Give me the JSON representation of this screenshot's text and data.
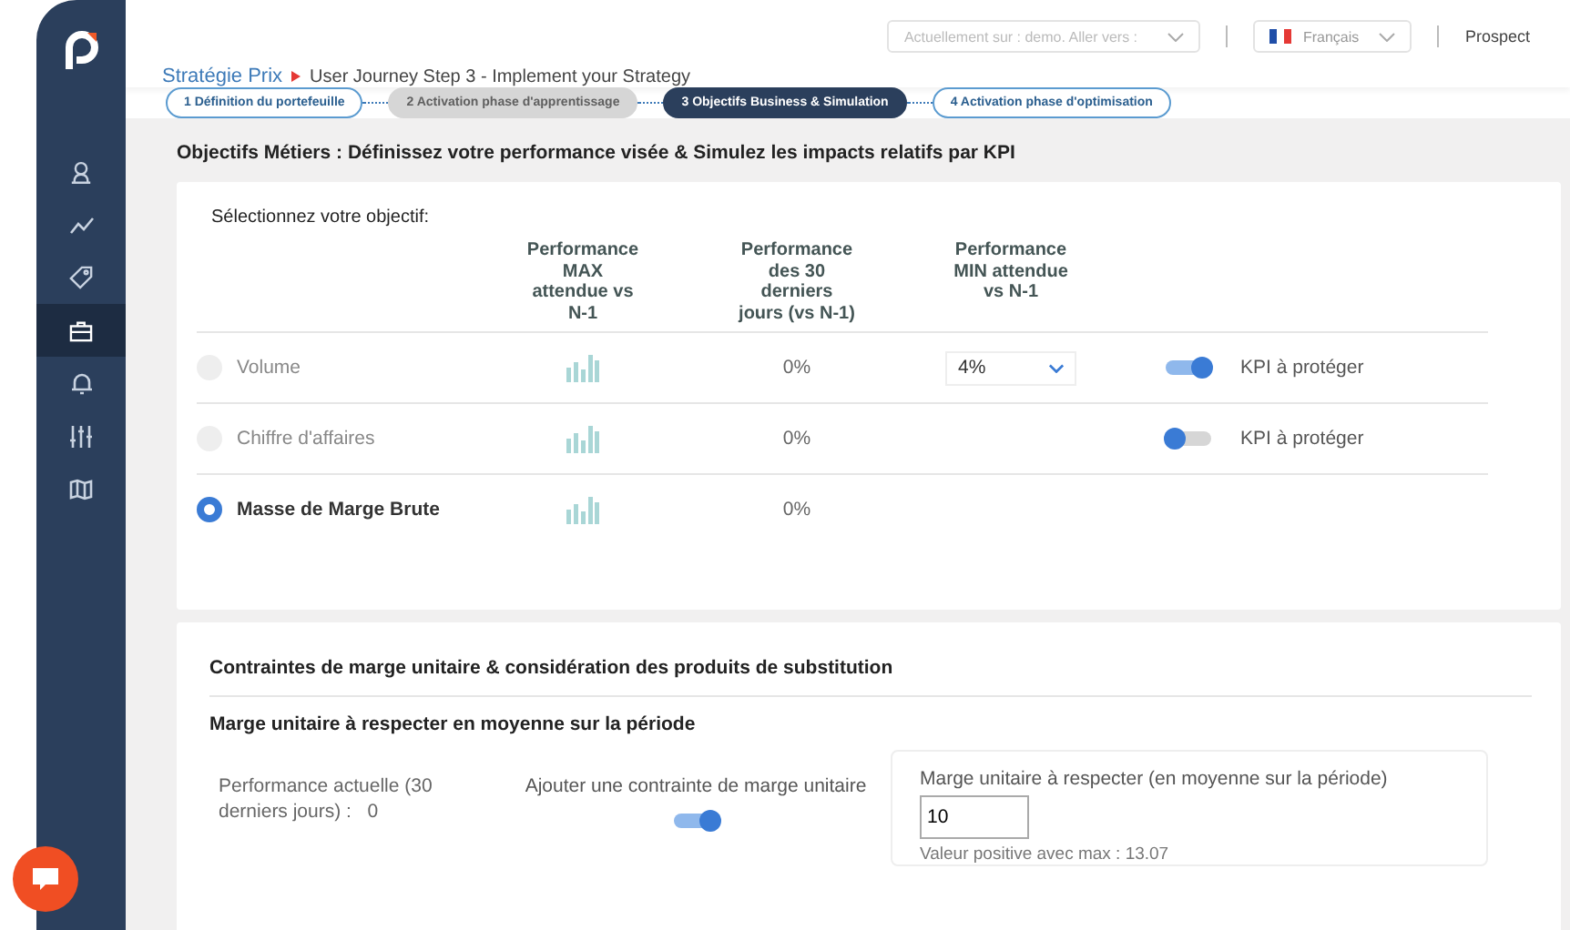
{
  "header": {
    "site_select": {
      "placeholder": "Actuellement sur : demo. Aller vers :"
    },
    "language_select": {
      "value": "Français"
    },
    "user": "Prospect"
  },
  "sidebar": {
    "items": [
      {
        "kind": "user",
        "selected": false
      },
      {
        "kind": "trend",
        "selected": false
      },
      {
        "kind": "tag",
        "selected": false
      },
      {
        "kind": "briefcase",
        "selected": true
      },
      {
        "kind": "bell",
        "selected": false
      },
      {
        "kind": "sliders",
        "selected": false
      },
      {
        "kind": "map",
        "selected": false
      }
    ]
  },
  "breadcrumb": {
    "parent": "Stratégie Prix",
    "current": "User Journey Step 3 - Implement your Strategy"
  },
  "steps": [
    {
      "label": "1 Définition du portefeuille",
      "selected": false,
      "disabled": false
    },
    {
      "label": "2 Activation phase d'apprentissage",
      "selected": false,
      "disabled": true
    },
    {
      "label": "3 Objectifs Business & Simulation",
      "selected": true,
      "disabled": false
    },
    {
      "label": "4 Activation phase d'optimisation",
      "selected": false,
      "disabled": false
    }
  ],
  "objectives": {
    "title": "Objectifs Métiers : Définissez votre performance visée & Simulez les impacts relatifs par KPI",
    "prompt": "Sélectionnez votre objectif:",
    "columns": [
      "Performance MAX attendue vs N-1",
      "Performance des 30 derniers jours (vs N-1)",
      "Performance MIN attendue vs N-1"
    ],
    "rows": [
      {
        "name": "Volume",
        "selected": false,
        "last_30_days": "0%",
        "min_expected": "4%",
        "kpi_toggle": {
          "label": "KPI à protéger",
          "on": true
        }
      },
      {
        "name": "Chiffre d'affaires",
        "selected": false,
        "last_30_days": "0%",
        "kpi_toggle": {
          "label": "KPI à protéger",
          "on": false
        }
      },
      {
        "name": "Masse de Marge Brute",
        "selected": true,
        "last_30_days": "0%"
      }
    ]
  },
  "constraints": {
    "title": "Contraintes de marge unitaire & considération des produits de substitution",
    "subtitle": "Marge unitaire à respecter en moyenne sur la période",
    "current_performance": {
      "label": "Performance actuelle (30 derniers jours) :",
      "value": "0"
    },
    "add_constraint": {
      "label": "Ajouter une contrainte de marge unitaire",
      "on": true
    },
    "margin_field": {
      "label": "Marge unitaire à respecter (en moyenne sur la période)",
      "value": "10",
      "hint": "Valeur positive avec max : 13.07"
    }
  }
}
